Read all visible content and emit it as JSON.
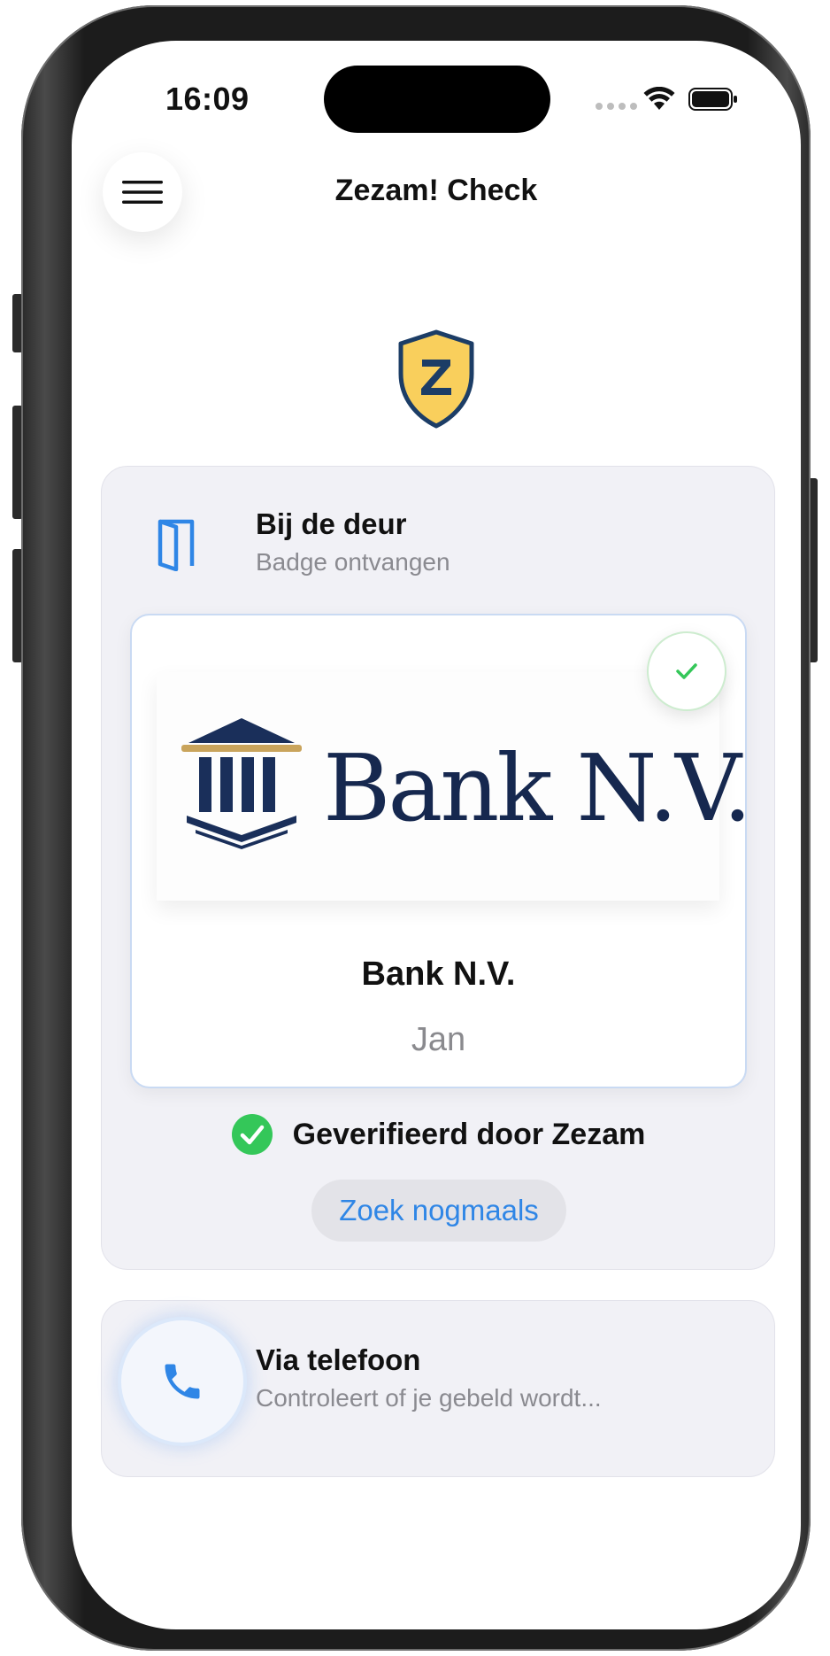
{
  "status_bar": {
    "time": "16:09"
  },
  "header": {
    "title": "Zezam! Check",
    "menu_icon": "hamburger-menu-icon",
    "logo_letter": "Z",
    "logo_colors": {
      "shield_fill": "#f9cf5c",
      "shield_stroke": "#1c3d66"
    }
  },
  "door_section": {
    "title": "Bij de deur",
    "subtitle": "Badge ontvangen",
    "icon": "door-icon",
    "badge": {
      "logo_wordmark": "Bank N.V.",
      "name": "Bank N.V.",
      "person": "Jan",
      "check_icon": "checkmark-icon"
    },
    "verified_text": "Geverifieerd door Zezam",
    "search_again_label": "Zoek nogmaals"
  },
  "phone_section": {
    "title": "Via telefoon",
    "subtitle": "Controleert of je gebeld wordt...",
    "icon": "phone-icon"
  },
  "colors": {
    "accent_blue": "#2f86e6",
    "verified_green": "#34c759",
    "section_bg": "#f1f1f6",
    "bank_navy": "#16284f",
    "bank_gold": "#c9a45c"
  }
}
